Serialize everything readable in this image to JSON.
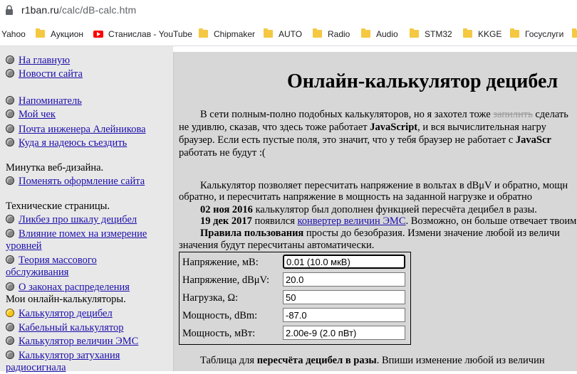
{
  "browser": {
    "url_host": "r1ban.ru",
    "url_path": "/calc/dB-calc.htm"
  },
  "bookmarks": [
    {
      "label": "Yahoo",
      "icon": "none"
    },
    {
      "label": "Аукцион",
      "icon": "folder-icon"
    },
    {
      "label": "Станислав - YouTube",
      "icon": "youtube-icon"
    },
    {
      "label": "Chipmaker",
      "icon": "folder-icon"
    },
    {
      "label": "AUTO",
      "icon": "folder-icon"
    },
    {
      "label": "Radio",
      "icon": "folder-icon"
    },
    {
      "label": "Audio",
      "icon": "folder-icon"
    },
    {
      "label": "STM32",
      "icon": "folder-icon"
    },
    {
      "label": "KKGE",
      "icon": "folder-icon"
    },
    {
      "label": "Госуслуги",
      "icon": "folder-icon"
    }
  ],
  "nav": {
    "home": "На главную",
    "news": "Новости сайта",
    "reminder": "Напоминатель",
    "chek": "Мой чек",
    "mail": "Почта инженера Алейникова",
    "travel": "Куда я надеюсь съездить",
    "webdesign_heading": "Минутка веб-дизайна.",
    "change_design": "Поменять оформление сайта",
    "tech_heading": "Технические страницы.",
    "likbez": "Ликбез про шкалу децибел",
    "interference": "Влияние помех на измерение уровней",
    "queue_theory": "Теория массового обслуживания",
    "distribution": "О законах распределения",
    "calcs_heading": "Мои онлайн-калькуляторы.",
    "db_calc": "Калькулятор децибел",
    "cable_calc": "Кабельный калькулятор",
    "emc_calc": "Калькулятор величин ЭМС",
    "attenuation_calc": "Калькулятор затухания радиосигнала"
  },
  "content": {
    "title": "Онлайн-калькулятор децибел",
    "p1_line1_a": "В сети полным-полно подобных калькуляторов, но я захотел тоже ",
    "p1_line1_strike": "запилить",
    "p1_line1_b": " сделать",
    "p1_line2_a": "не удивлю, сказав, что здесь тоже работает ",
    "p1_line2_bold": "JavaScript",
    "p1_line2_b": ", и вся вычислительная нагру",
    "p1_line3_a": "браузер. Если есть пустые поля, это значит, что у тебя браузер не работает с ",
    "p1_line3_bold": "JavaScr",
    "p1_line4": "работать не будут :(",
    "p2_line1": "Калькулятор позволяет пересчитать напряжение в вольтах в dBμV и обратно, мощн",
    "p2_line2": "обратно, и пересчитать напряжение в мощность на заданной нагрузке и обратно",
    "update1_date": "02 ноя 2016",
    "update1_text": " калькулятор был дополнен функцией пересчёта децибел в разы.",
    "update2_date": "19 дек 2017",
    "update2_text_a": " появился ",
    "update2_link": "конвертер величин ЭМС",
    "update2_text_b": ". Возможно, он больше отвечает твоим",
    "rules_bold": "Правила пользования",
    "rules_text": " просты до безобразия. Измени значение любой из величи",
    "rules_line2": "значения будут пересчитаны автоматически.",
    "bottom_a": "Таблица для ",
    "bottom_bold": "пересчёта децибел в разы",
    "bottom_b": ". Впиши изменение любой из величин"
  },
  "calculator": {
    "rows": [
      {
        "label": "Напряжение, мВ:",
        "value": "0.01 (10.0 мкВ)"
      },
      {
        "label": "Напряжение, dBμV:",
        "value": "20.0"
      },
      {
        "label": "Нагрузка, Ω:",
        "value": "50"
      },
      {
        "label": "Мощность, dBm:",
        "value": "-87.0"
      },
      {
        "label": "Мощность, мВт:",
        "value": "2.00e-9 (2.0 пВт)"
      }
    ]
  },
  "colors": {
    "link": "#1a0dab",
    "content_bg": "#d7d7d7",
    "nav_bg": "#e8e8e8",
    "active_bullet": "#f5c518"
  }
}
